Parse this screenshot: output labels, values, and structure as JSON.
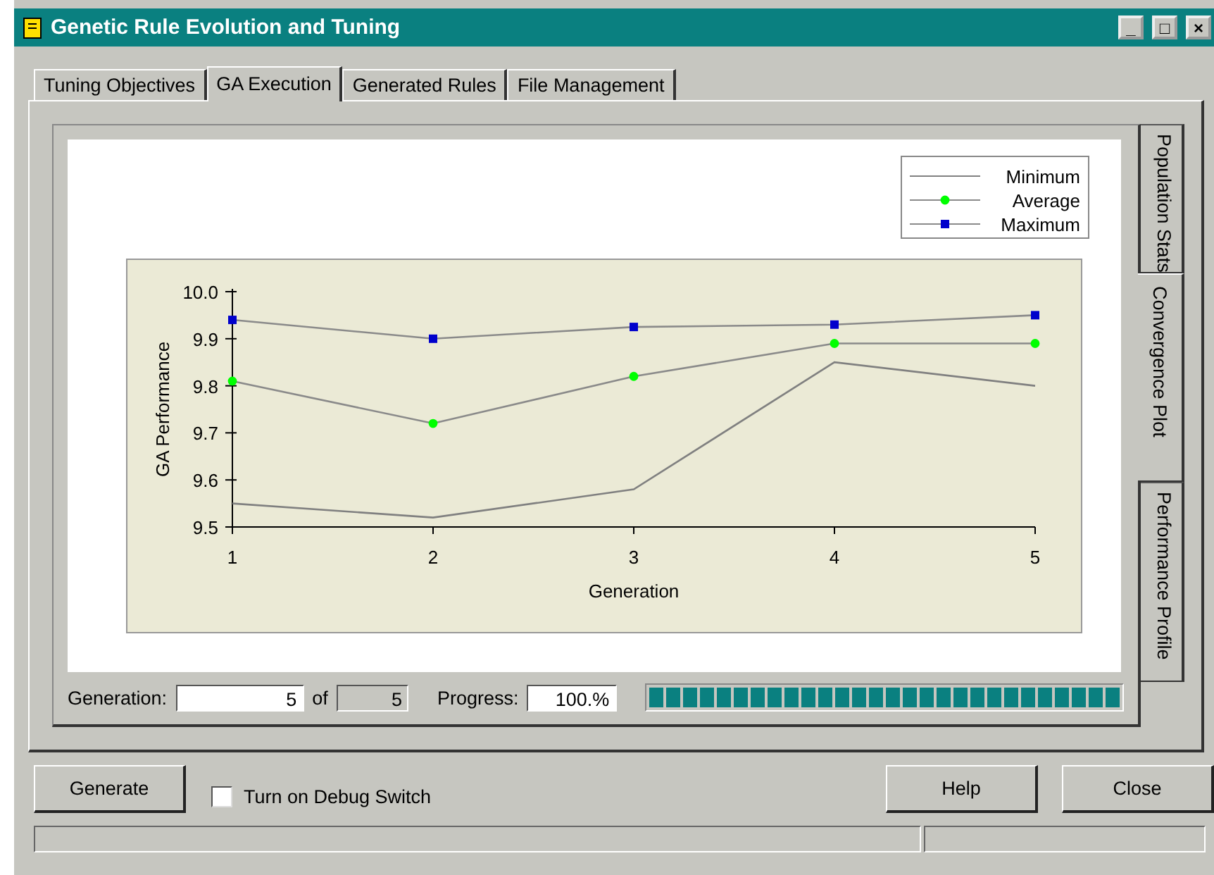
{
  "window": {
    "title": "Genetic Rule Evolution and Tuning"
  },
  "tabs": [
    {
      "label": "Tuning Objectives",
      "selected": false
    },
    {
      "label": "GA Execution",
      "selected": true
    },
    {
      "label": "Generated Rules",
      "selected": false
    },
    {
      "label": "File Management",
      "selected": false
    }
  ],
  "side_tabs": [
    {
      "label": "Population Stats",
      "selected": false
    },
    {
      "label": "Convergence Plot",
      "selected": true
    },
    {
      "label": "Performance Profile",
      "selected": false
    }
  ],
  "chart": {
    "chart_data": {
      "type": "line",
      "xlabel": "Generation",
      "ylabel": "GA Performance",
      "categories": [
        "1",
        "2",
        "3",
        "4",
        "5"
      ],
      "series": [
        {
          "name": "Minimum",
          "color": "#808080",
          "marker": "none",
          "values": [
            9.55,
            9.52,
            9.58,
            9.85,
            9.8
          ]
        },
        {
          "name": "Average",
          "color": "#00ff00",
          "marker": "circle",
          "values": [
            9.81,
            9.72,
            9.82,
            9.89,
            9.89
          ]
        },
        {
          "name": "Maximum",
          "color": "#0000cc",
          "marker": "square",
          "values": [
            9.94,
            9.9,
            9.925,
            9.93,
            9.95
          ]
        }
      ],
      "legend": true,
      "ylim": [
        9.5,
        10.0
      ],
      "yticks": [
        9.5,
        9.6,
        9.7,
        9.8,
        9.9,
        {
          "value": 10.0,
          "label": "10.0"
        }
      ]
    }
  },
  "status": {
    "generation_label": "Generation:",
    "generation": "5",
    "of_label": "of",
    "total": "5",
    "progress_label": "Progress:",
    "progress": "100.%",
    "level": 1.0
  },
  "buttons": {
    "generate": "Generate",
    "help": "Help",
    "close": "Close"
  },
  "debug": {
    "label": "Turn on Debug Switch",
    "checked": false
  },
  "title_buttons": [
    "_",
    "□",
    "×"
  ]
}
